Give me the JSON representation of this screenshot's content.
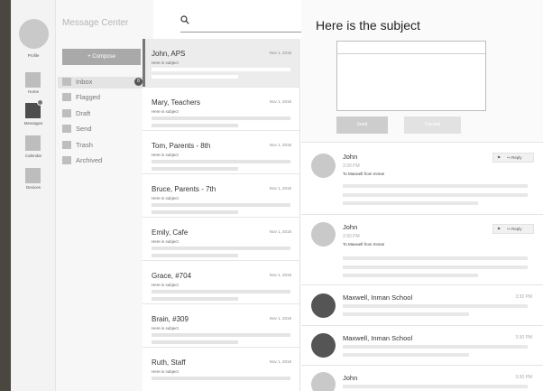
{
  "rail": {
    "profile_label": "Profile",
    "items": [
      {
        "label": "Home",
        "icon": "home-icon"
      },
      {
        "label": "Messages",
        "icon": "messages-icon"
      },
      {
        "label": "Calendar",
        "icon": "calendar-icon"
      },
      {
        "label": "Devices",
        "icon": "devices-icon"
      }
    ]
  },
  "folders": {
    "title": "Message Center",
    "compose_label": "+ Compose",
    "items": [
      {
        "label": "Inbox",
        "badge": "8"
      },
      {
        "label": "Flagged"
      },
      {
        "label": "Draft"
      },
      {
        "label": "Send"
      },
      {
        "label": "Trash"
      },
      {
        "label": "Archived"
      }
    ]
  },
  "search": {
    "icon": "search-icon"
  },
  "messages": [
    {
      "name": "John, APS",
      "date": "Nov 1, 2018",
      "subject": "Here is subject"
    },
    {
      "name": "Mary, Teachers",
      "date": "Nov 1, 2018",
      "subject": "Here is subject"
    },
    {
      "name": "Tom, Parents - 8th",
      "date": "Nov 1, 2018",
      "subject": "Here is subject"
    },
    {
      "name": "Bruce, Parents - 7th",
      "date": "Nov 1, 2018",
      "subject": "Here is subject"
    },
    {
      "name": "Emily, Cafe",
      "date": "Nov 1, 2018",
      "subject": "Here is subject"
    },
    {
      "name": "Grace, #704",
      "date": "Nov 1, 2018",
      "subject": "Here is subject"
    },
    {
      "name": "Brain, #309",
      "date": "Nov 1, 2018",
      "subject": "Here is subject"
    },
    {
      "name": "Ruth, Staff",
      "date": "Nov 1, 2018",
      "subject": "Here is subject"
    }
  ],
  "detail": {
    "title": "Here is the subject",
    "send_label": "Send",
    "discard_label": "Discard",
    "thread": [
      {
        "sender": "John",
        "time": "3:30 PM",
        "to": "To Maxwell from Inman",
        "reply_label": "Reply"
      },
      {
        "sender": "John",
        "time": "3:30 PM",
        "to": "To Maxwell from Inman",
        "reply_label": "Reply"
      },
      {
        "sender": "Maxwell, Inman School",
        "time": "3:30 PM"
      },
      {
        "sender": "Maxwell, Inman School",
        "time": "3:30 PM"
      },
      {
        "sender": "John",
        "time": "3:30 PM"
      }
    ]
  }
}
